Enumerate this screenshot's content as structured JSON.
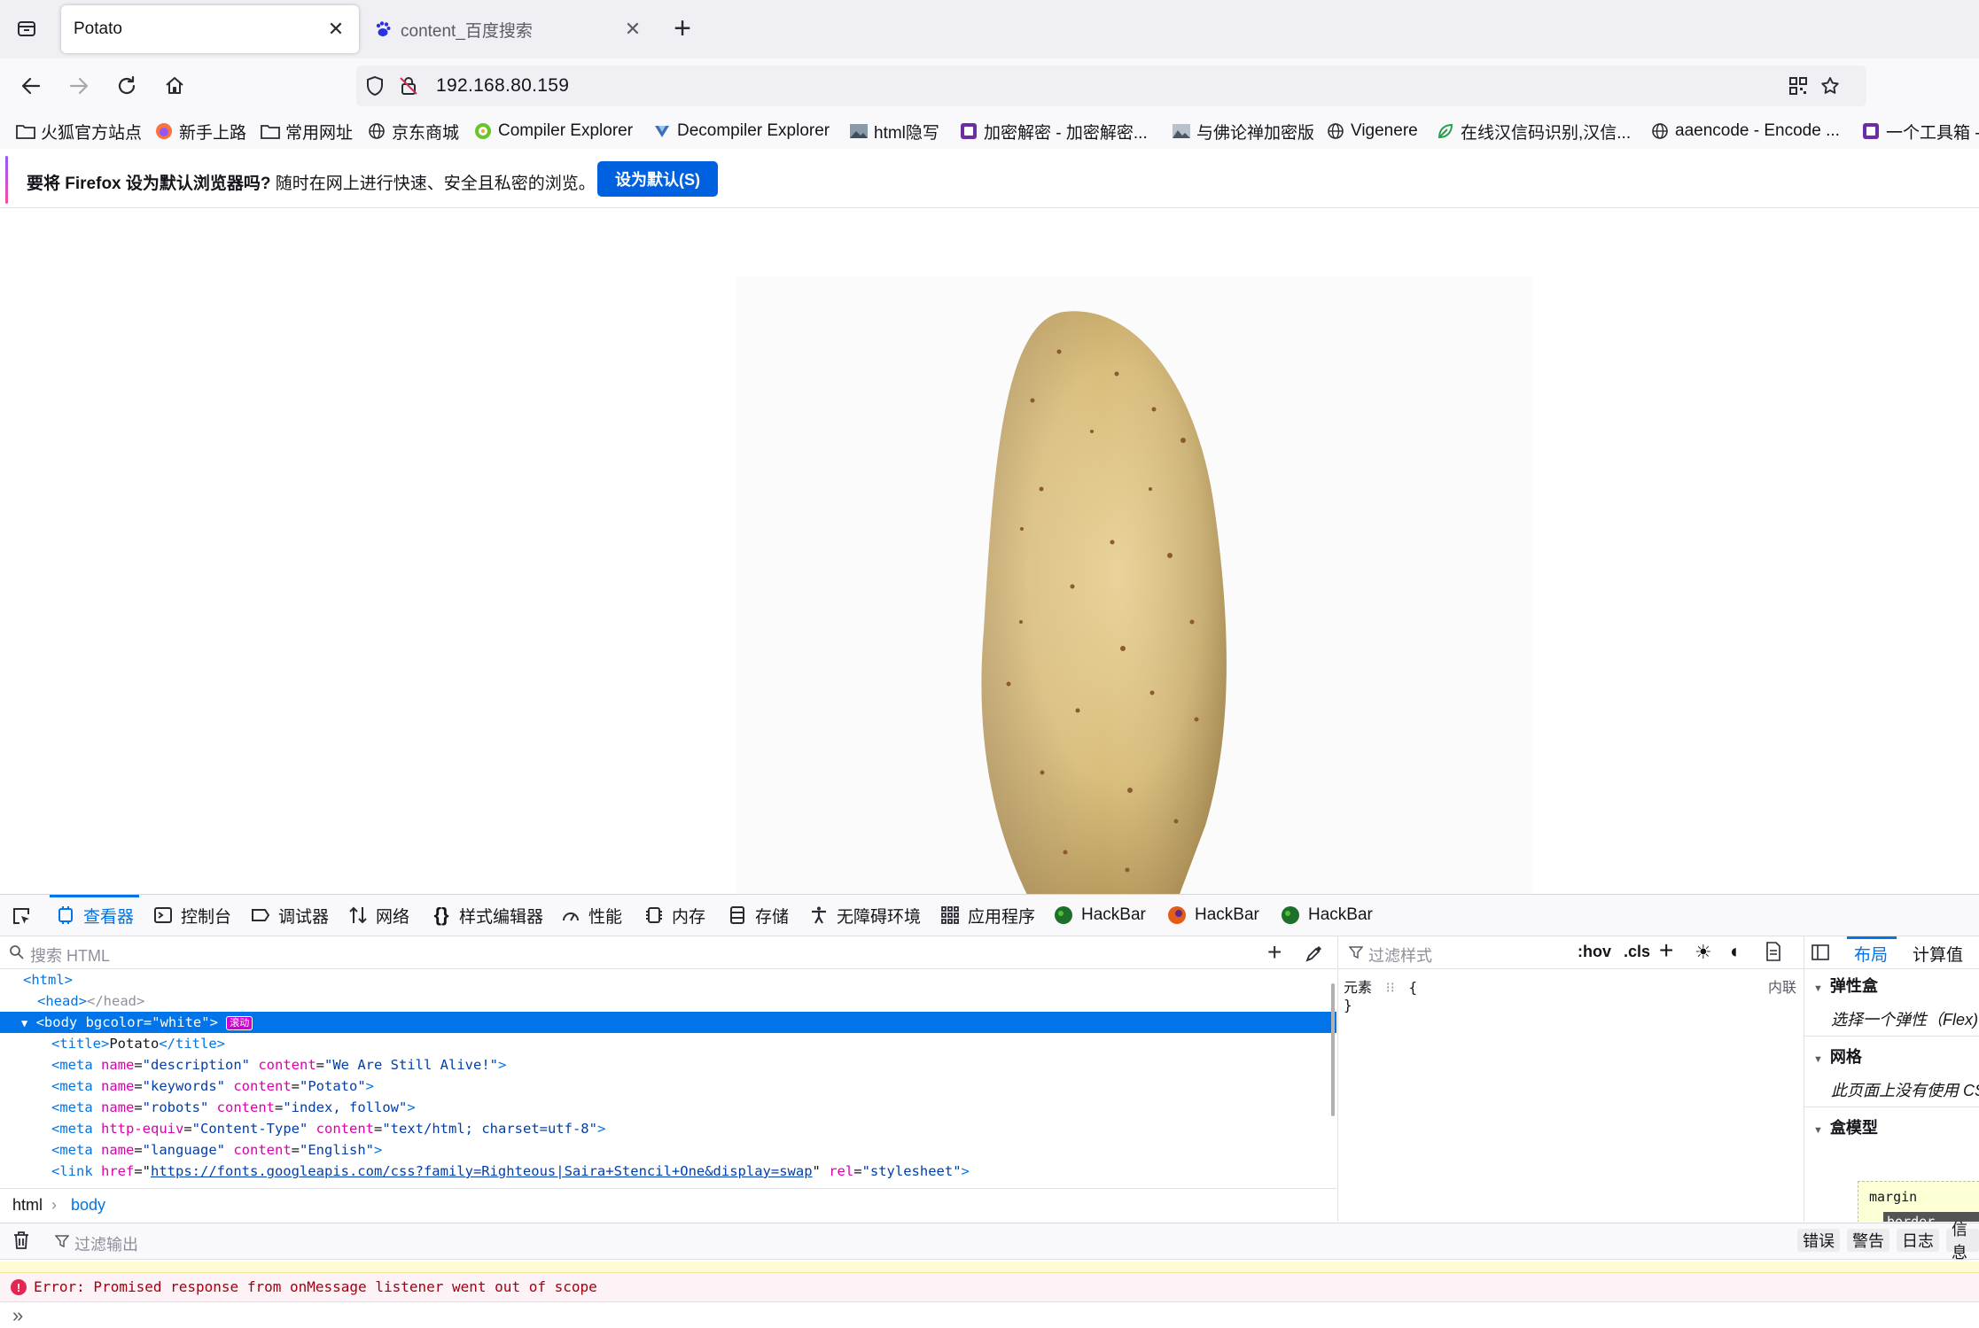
{
  "browser": {
    "tabs": [
      {
        "title": "Potato",
        "active": true
      },
      {
        "title": "content_百度搜索",
        "active": false
      }
    ],
    "url": "192.168.80.159",
    "bookmarks": [
      {
        "label": "火狐官方站点",
        "icon": "folder-icon"
      },
      {
        "label": "新手上路",
        "icon": "firefox-icon"
      },
      {
        "label": "常用网址",
        "icon": "folder-icon"
      },
      {
        "label": "京东商城",
        "icon": "globe-icon"
      },
      {
        "label": "Compiler Explorer",
        "icon": "compiler-explorer-icon"
      },
      {
        "label": "Decompiler Explorer",
        "icon": "decompiler-icon"
      },
      {
        "label": "html隐写",
        "icon": "image-icon"
      },
      {
        "label": "加密解密 - 加密解密...",
        "icon": "crypto-icon"
      },
      {
        "label": "与佛论禅加密版",
        "icon": "image-icon"
      },
      {
        "label": "Vigenere",
        "icon": "globe-icon"
      },
      {
        "label": "在线汉信码识别,汉信...",
        "icon": "leaf-icon"
      },
      {
        "label": "aaencode - Encode ...",
        "icon": "globe-icon"
      },
      {
        "label": "一个工具箱 -",
        "icon": "crypto-icon"
      }
    ],
    "notification": {
      "bold": "要将 Firefox 设为默认浏览器吗?",
      "text": " 随时在网上进行快速、安全且私密的浏览。",
      "button": "设为默认(S)"
    }
  },
  "devtools": {
    "tabs": [
      {
        "label": "查看器",
        "icon": "inspector-icon",
        "selected": true
      },
      {
        "label": "控制台",
        "icon": "console-icon"
      },
      {
        "label": "调试器",
        "icon": "debugger-icon"
      },
      {
        "label": "网络",
        "icon": "network-icon"
      },
      {
        "label": "样式编辑器",
        "icon": "style-editor-icon"
      },
      {
        "label": "性能",
        "icon": "performance-icon"
      },
      {
        "label": "内存",
        "icon": "memory-icon"
      },
      {
        "label": "存储",
        "icon": "storage-icon"
      },
      {
        "label": "无障碍环境",
        "icon": "accessibility-icon"
      },
      {
        "label": "应用程序",
        "icon": "application-icon"
      },
      {
        "label": "HackBar",
        "icon": "hackbar-green-icon"
      },
      {
        "label": "HackBar",
        "icon": "hackbar-orange-icon"
      },
      {
        "label": "HackBar",
        "icon": "hackbar-green-icon"
      }
    ],
    "inspector": {
      "search_placeholder": "搜索 HTML",
      "markup": {
        "html_open": "<html>",
        "head_line": {
          "open": "<head>",
          "close": "</head>"
        },
        "body_line": {
          "tag": "body",
          "attr": "bgcolor",
          "value": "\"white\"",
          "badge": "滚动"
        },
        "title_line": {
          "open": "<title>",
          "text": "Potato",
          "close": "</title>"
        },
        "meta_lines": [
          {
            "a1": "name",
            "v1": "\"description\"",
            "a2": "content",
            "v2": "\"We Are Still Alive!\""
          },
          {
            "a1": "name",
            "v1": "\"keywords\"",
            "a2": "content",
            "v2": "\"Potato\""
          },
          {
            "a1": "name",
            "v1": "\"robots\"",
            "a2": "content",
            "v2": "\"index, follow\""
          },
          {
            "a1": "http-equiv",
            "v1": "\"Content-Type\"",
            "a2": "content",
            "v2": "\"text/html; charset=utf-8\""
          },
          {
            "a1": "name",
            "v1": "\"language\"",
            "a2": "content",
            "v2": "\"English\""
          }
        ],
        "link_line": {
          "a1": "href",
          "v1": "https://fonts.googleapis.com/css?family=Righteous|Saira+Stencil+One&display=swap",
          "a2": "rel",
          "v2": "\"stylesheet\""
        }
      },
      "breadcrumb": [
        "html",
        "body"
      ]
    },
    "rules": {
      "filter_placeholder": "过滤样式",
      "hov": ":hov",
      "cls": ".cls",
      "element_rule": "元素",
      "open_brace": "{",
      "close_brace": "}",
      "inline_label": "内联"
    },
    "layout": {
      "tabs": [
        "布局",
        "计算值"
      ],
      "flexbox_title": "弹性盒",
      "flexbox_body": "选择一个弹性（Flex)",
      "grid_title": "网格",
      "grid_body": "此页面上没有使用 CS",
      "boxmodel_title": "盒模型",
      "margin_label": "margin",
      "border_label": "border"
    },
    "console": {
      "filter_placeholder": "过滤输出",
      "filters": [
        "错误",
        "警告",
        "日志",
        "信息"
      ],
      "error_message": "Error: Promised response from onMessage listener went out of scope",
      "prompt": "»"
    }
  },
  "colors": {
    "accent": "#0074e8",
    "set_default_button": "#0061e0",
    "error_text": "#a4000f"
  }
}
